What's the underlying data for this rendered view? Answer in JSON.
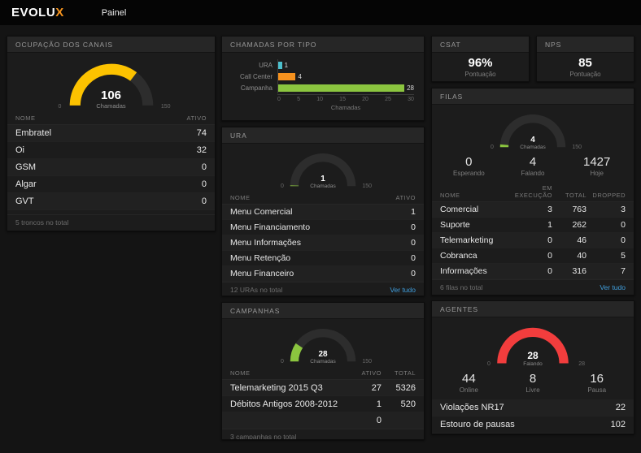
{
  "header": {
    "logo_text": "EVOLU",
    "logo_accent": "X",
    "nav_painel": "Painel"
  },
  "colors": {
    "accent_orange": "#f7941e",
    "link_blue": "#3f9edd",
    "gauge_track": "#2d2d2d"
  },
  "panels": {
    "canais": {
      "title": "OCUPAÇÃO DOS CANAIS",
      "gauge": {
        "value": 106,
        "max": 150,
        "label": "Chamadas",
        "min_label": "0",
        "max_label": "150",
        "color": "#fcc200"
      },
      "headers": {
        "name": "NOME",
        "ativo": "ATIVO"
      },
      "rows": [
        {
          "name": "Embratel",
          "ativo": "74"
        },
        {
          "name": "Oi",
          "ativo": "32"
        },
        {
          "name": "GSM",
          "ativo": "0"
        },
        {
          "name": "Algar",
          "ativo": "0"
        },
        {
          "name": "GVT",
          "ativo": "0"
        }
      ],
      "footer": "5 troncos no total"
    },
    "tipo": {
      "title": "CHAMADAS POR TIPO",
      "xmax": 30,
      "xticks": [
        "0",
        "5",
        "10",
        "15",
        "20",
        "25",
        "30"
      ],
      "xlabel": "Chamadas",
      "bars": [
        {
          "label": "URA",
          "value": 1,
          "color": "#4cc0cd"
        },
        {
          "label": "Call Center",
          "value": 4,
          "color": "#f6921e"
        },
        {
          "label": "Campanha",
          "value": 28,
          "color": "#8bc53f"
        }
      ]
    },
    "ura": {
      "title": "URA",
      "gauge": {
        "value": 1,
        "max": 150,
        "label": "Chamadas",
        "min_label": "0",
        "max_label": "150",
        "color": "#8bc53f"
      },
      "headers": {
        "name": "NOME",
        "ativo": "ATIVO"
      },
      "rows": [
        {
          "name": "Menu Comercial",
          "ativo": "1"
        },
        {
          "name": "Menu Financiamento",
          "ativo": "0"
        },
        {
          "name": "Menu Informações",
          "ativo": "0"
        },
        {
          "name": "Menu Retenção",
          "ativo": "0"
        },
        {
          "name": "Menu Financeiro",
          "ativo": "0"
        }
      ],
      "footer": "12 URAs no total",
      "link": "Ver tudo"
    },
    "campanhas": {
      "title": "CAMPANHAS",
      "gauge": {
        "value": 28,
        "max": 150,
        "label": "Chamadas",
        "min_label": "0",
        "max_label": "150",
        "color": "#8bc53f"
      },
      "headers": {
        "name": "NOME",
        "ativo": "ATIVO",
        "total": "TOTAL"
      },
      "rows": [
        {
          "name": "Telemarketing 2015 Q3",
          "ativo": "27",
          "total": "5326"
        },
        {
          "name": "Débitos Antigos 2008-2012",
          "ativo": "1",
          "total": "520"
        },
        {
          "name": "",
          "ativo": "0",
          "total": ""
        }
      ],
      "footer": "3 campanhas no total"
    },
    "csat": {
      "title": "CSAT",
      "value": "96%",
      "label": "Pontuação"
    },
    "nps": {
      "title": "NPS",
      "value": "85",
      "label": "Pontuação"
    },
    "filas": {
      "title": "FILAS",
      "gauge": {
        "value": 4,
        "max": 150,
        "label": "Chamadas",
        "min_label": "0",
        "max_label": "150",
        "color": "#8bc53f"
      },
      "stats": [
        {
          "value": "0",
          "label": "Esperando"
        },
        {
          "value": "4",
          "label": "Falando"
        },
        {
          "value": "1427",
          "label": "Hoje"
        }
      ],
      "headers": {
        "name": "NOME",
        "exec": "EM EXECUÇÃO",
        "total": "TOTAL",
        "dropped": "DROPPED"
      },
      "rows": [
        {
          "name": "Comercial",
          "exec": "3",
          "total": "763",
          "dropped": "3"
        },
        {
          "name": "Suporte",
          "exec": "1",
          "total": "262",
          "dropped": "0"
        },
        {
          "name": "Telemarketing",
          "exec": "0",
          "total": "46",
          "dropped": "0"
        },
        {
          "name": "Cobranca",
          "exec": "0",
          "total": "40",
          "dropped": "5"
        },
        {
          "name": "Informações",
          "exec": "0",
          "total": "316",
          "dropped": "7"
        }
      ],
      "footer": "6 filas no total",
      "link": "Ver tudo"
    },
    "agentes": {
      "title": "AGENTES",
      "gauge": {
        "value": 28,
        "max": 28,
        "label": "Falando",
        "min_label": "0",
        "max_label": "28",
        "color": "#f23d3d"
      },
      "stats": [
        {
          "value": "44",
          "label": "Online"
        },
        {
          "value": "8",
          "label": "Livre"
        },
        {
          "value": "16",
          "label": "Pausa"
        }
      ],
      "rows": [
        {
          "name": "Violações NR17",
          "value": "22"
        },
        {
          "name": "Estouro de pausas",
          "value": "102"
        }
      ]
    }
  }
}
